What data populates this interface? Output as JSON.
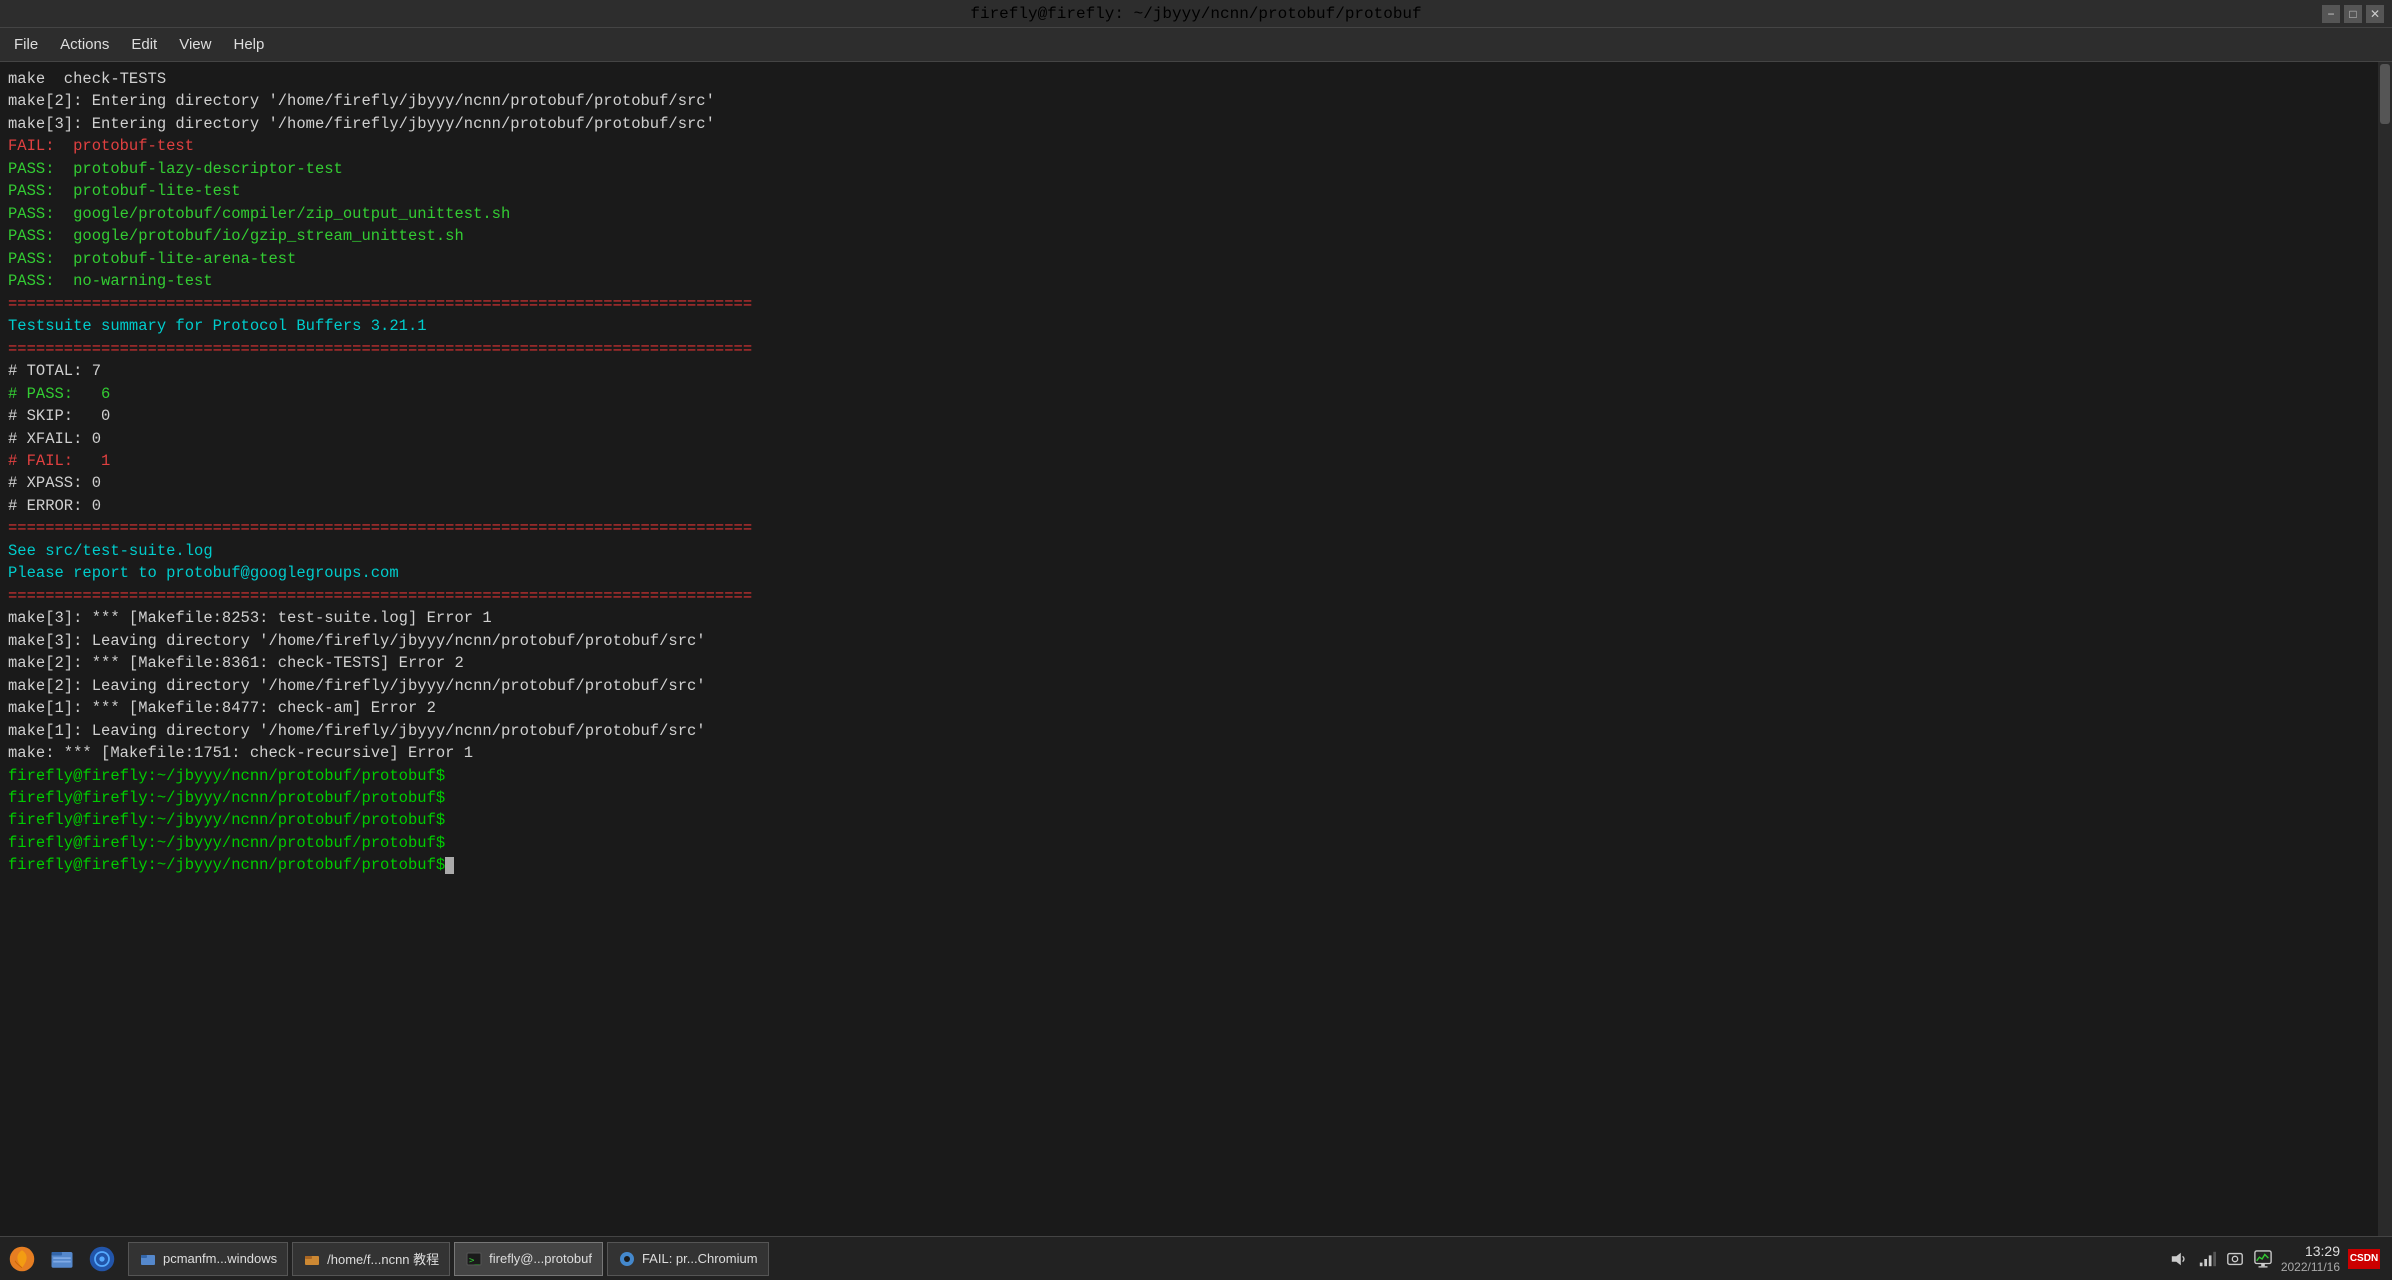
{
  "titlebar": {
    "title": "firefly@firefly: ~/jbyyy/ncnn/protobuf/protobuf",
    "min_label": "−",
    "max_label": "□",
    "close_label": "✕"
  },
  "menubar": {
    "items": [
      "File",
      "Actions",
      "Edit",
      "View",
      "Help"
    ]
  },
  "terminal": {
    "lines": [
      {
        "text": "make  check-TESTS",
        "color": "white"
      },
      {
        "text": "make[2]: Entering directory '/home/firefly/jbyyy/ncnn/protobuf/protobuf/src'",
        "color": "white"
      },
      {
        "text": "make[3]: Entering directory '/home/firefly/jbyyy/ncnn/protobuf/protobuf/src'",
        "color": "white"
      },
      {
        "text": "FAIL:  protobuf-test",
        "color": "red"
      },
      {
        "text": "PASS:  protobuf-lazy-descriptor-test",
        "color": "green"
      },
      {
        "text": "PASS:  protobuf-lite-test",
        "color": "green"
      },
      {
        "text": "PASS:  google/protobuf/compiler/zip_output_unittest.sh",
        "color": "green"
      },
      {
        "text": "PASS:  google/protobuf/io/gzip_stream_unittest.sh",
        "color": "green"
      },
      {
        "text": "PASS:  protobuf-lite-arena-test",
        "color": "green"
      },
      {
        "text": "PASS:  no-warning-test",
        "color": "green"
      },
      {
        "text": "================================================================================",
        "color": "red-dashed"
      },
      {
        "text": "Testsuite summary for Protocol Buffers 3.21.1",
        "color": "cyan"
      },
      {
        "text": "================================================================================",
        "color": "red-dashed"
      },
      {
        "text": "# TOTAL: 7",
        "color": "white"
      },
      {
        "text": "# PASS:   6",
        "color": "green"
      },
      {
        "text": "# SKIP:   0",
        "color": "white"
      },
      {
        "text": "# XFAIL: 0",
        "color": "white"
      },
      {
        "text": "# FAIL:   1",
        "color": "red"
      },
      {
        "text": "# XPASS: 0",
        "color": "white"
      },
      {
        "text": "# ERROR: 0",
        "color": "white"
      },
      {
        "text": "================================================================================",
        "color": "red-dashed"
      },
      {
        "text": "See src/test-suite.log",
        "color": "cyan"
      },
      {
        "text": "Please report to protobuf@googlegroups.com",
        "color": "cyan"
      },
      {
        "text": "================================================================================",
        "color": "red-dashed"
      },
      {
        "text": "make[3]: *** [Makefile:8253: test-suite.log] Error 1",
        "color": "white"
      },
      {
        "text": "make[3]: Leaving directory '/home/firefly/jbyyy/ncnn/protobuf/protobuf/src'",
        "color": "white"
      },
      {
        "text": "make[2]: *** [Makefile:8361: check-TESTS] Error 2",
        "color": "white"
      },
      {
        "text": "make[2]: Leaving directory '/home/firefly/jbyyy/ncnn/protobuf/protobuf/src'",
        "color": "white"
      },
      {
        "text": "make[1]: *** [Makefile:8477: check-am] Error 2",
        "color": "white"
      },
      {
        "text": "make[1]: Leaving directory '/home/firefly/jbyyy/ncnn/protobuf/protobuf/src'",
        "color": "white"
      },
      {
        "text": "make: *** [Makefile:1751: check-recursive] Error 1",
        "color": "white"
      },
      {
        "text": "firefly@firefly:~/jbyyy/ncnn/protobuf/protobuf$",
        "color": "prompt",
        "is_prompt": true
      },
      {
        "text": "firefly@firefly:~/jbyyy/ncnn/protobuf/protobuf$",
        "color": "prompt",
        "is_prompt": true
      },
      {
        "text": "firefly@firefly:~/jbyyy/ncnn/protobuf/protobuf$",
        "color": "prompt",
        "is_prompt": true
      },
      {
        "text": "firefly@firefly:~/jbyyy/ncnn/protobuf/protobuf$",
        "color": "prompt",
        "is_prompt": true
      },
      {
        "text": "firefly@firefly:~/jbyyy/ncnn/protobuf/protobuf$",
        "color": "prompt",
        "is_prompt": true,
        "has_cursor": true
      }
    ]
  },
  "taskbar": {
    "apps": [
      {
        "name": "app-launcher",
        "label": "App Launcher"
      },
      {
        "name": "files-icon",
        "label": "Files"
      },
      {
        "name": "browser-icon",
        "label": "Browser"
      }
    ],
    "buttons": [
      {
        "id": "pcmanfm",
        "label": "pcmanfm...windows",
        "active": false
      },
      {
        "id": "home-folder",
        "label": "/home/f...ncnn 教程",
        "active": false
      },
      {
        "id": "terminal",
        "label": "firefly@...protobuf",
        "active": true
      },
      {
        "id": "chromium",
        "label": "FAIL: pr...Chromium",
        "active": false
      }
    ],
    "right": {
      "time": "13:29",
      "date": "2022/11/16"
    }
  }
}
